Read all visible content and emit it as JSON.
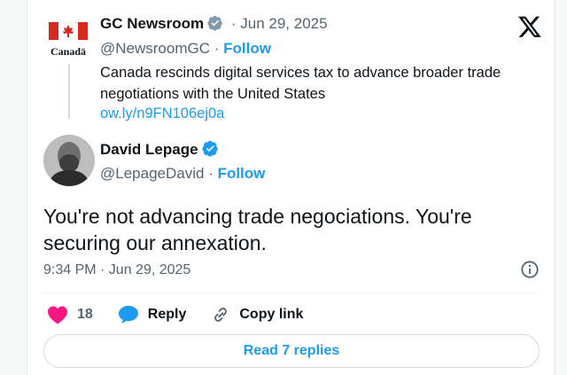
{
  "quoted_tweet": {
    "avatar_caption": "Canada",
    "name": "GC Newsroom",
    "date": "Jun 29, 2025",
    "handle": "@NewsroomGC",
    "follow_label": "Follow",
    "text": "Canada rescinds digital services tax to advance broader trade negotiations with the United States",
    "link": "ow.ly/n9FN106ej0a"
  },
  "main_tweet": {
    "name": "David Lepage",
    "handle": "@LepageDavid",
    "follow_label": "Follow",
    "text": "You're not advancing trade negociations. You're securing our annexation.",
    "timestamp": "9:34 PM · Jun 29, 2025"
  },
  "actions": {
    "like_count": "18",
    "reply_label": "Reply",
    "copy_link_label": "Copy link"
  },
  "read_replies_label": "Read 7 replies",
  "colors": {
    "accent": "#1d9bf0",
    "like": "#f91880",
    "text": "#0f1419",
    "muted": "#536471"
  },
  "icons": [
    "x-logo-icon",
    "verified-badge-icon",
    "info-icon",
    "heart-icon",
    "reply-bubble-icon",
    "link-icon"
  ]
}
